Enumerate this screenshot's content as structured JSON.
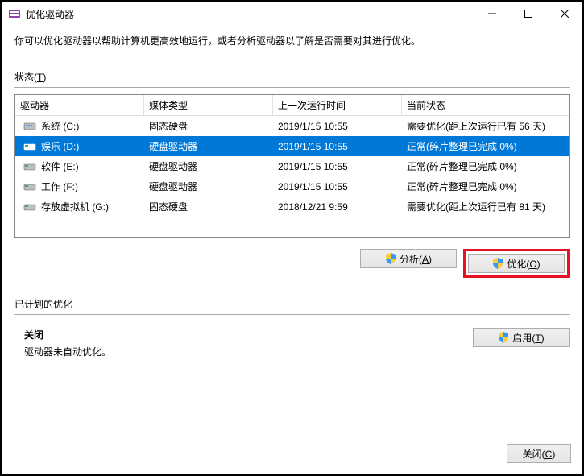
{
  "titlebar": {
    "title": "优化驱动器"
  },
  "description": "你可以优化驱动器以帮助计算机更高效地运行，或者分析驱动器以了解是否需要对其进行优化。",
  "status_label": "状态(T)",
  "columns": {
    "drive": "驱动器",
    "media": "媒体类型",
    "lastrun": "上一次运行时间",
    "status": "当前状态"
  },
  "drives": [
    {
      "name": "系统 (C:)",
      "media": "固态硬盘",
      "lastrun": "2019/1/15 10:55",
      "status": "需要优化(距上次运行已有 56 天)",
      "selected": false,
      "iconType": "ssd"
    },
    {
      "name": "娱乐 (D:)",
      "media": "硬盘驱动器",
      "lastrun": "2019/1/15 10:55",
      "status": "正常(碎片整理已完成 0%)",
      "selected": true,
      "iconType": "hdd"
    },
    {
      "name": "软件 (E:)",
      "media": "硬盘驱动器",
      "lastrun": "2019/1/15 10:55",
      "status": "正常(碎片整理已完成 0%)",
      "selected": false,
      "iconType": "hdd"
    },
    {
      "name": "工作 (F:)",
      "media": "硬盘驱动器",
      "lastrun": "2019/1/15 10:55",
      "status": "正常(碎片整理已完成 0%)",
      "selected": false,
      "iconType": "hdd"
    },
    {
      "name": "存放虚拟机 (G:)",
      "media": "固态硬盘",
      "lastrun": "2018/12/21 9:59",
      "status": "需要优化(距上次运行已有 81 天)",
      "selected": false,
      "iconType": "hdd"
    }
  ],
  "buttons": {
    "analyze": "分析(A)",
    "optimize": "优化(O)",
    "enable": "启用(T)",
    "close": "关闭(C)"
  },
  "scheduled": {
    "label": "已计划的优化",
    "title": "关闭",
    "desc": "驱动器未自动优化。"
  }
}
